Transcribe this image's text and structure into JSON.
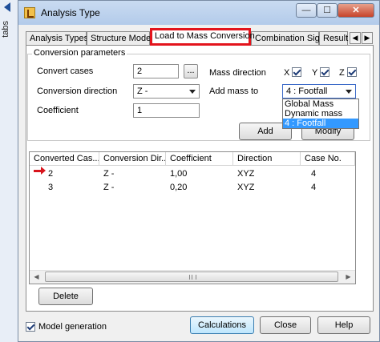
{
  "side": {
    "label": "tabs"
  },
  "window": {
    "title": "Analysis Type",
    "minimize": "—",
    "maximize": "☐",
    "close": "✕"
  },
  "tabs": [
    {
      "label": "Analysis Types"
    },
    {
      "label": "Structure Model"
    },
    {
      "label": "Load to Mass Conversion"
    },
    {
      "label": "Combination Sign"
    },
    {
      "label": "Result"
    }
  ],
  "tab_scroll": {
    "left": "◀",
    "right": "▶"
  },
  "conversion": {
    "group_title": "Conversion parameters",
    "convert_cases_label": "Convert cases",
    "convert_cases_value": "2",
    "browse_label": "...",
    "conversion_direction_label": "Conversion direction",
    "conversion_direction_value": "Z -",
    "coefficient_label": "Coefficient",
    "coefficient_value": "1",
    "mass_direction_label": "Mass direction",
    "mass_x": "X",
    "mass_y": "Y",
    "mass_z": "Z",
    "add_mass_to_label": "Add mass to",
    "add_mass_to_value": "4 : Footfall",
    "dropdown_options": [
      "Global Mass",
      "Dynamic mass",
      "4 : Footfall"
    ],
    "add_button": "Add",
    "modify_button": "Modify"
  },
  "table": {
    "columns": [
      "Converted Cas...",
      "Conversion Dir...",
      "Coefficient",
      "Direction",
      "Case No."
    ],
    "rows": [
      [
        "2",
        "Z -",
        "1,00",
        "XYZ",
        "4"
      ],
      [
        "3",
        "Z -",
        "0,20",
        "XYZ",
        "4"
      ]
    ],
    "scroll_left": "◀",
    "scroll_right": "▶"
  },
  "delete_button": "Delete",
  "footer": {
    "model_generation_label": "Model generation",
    "calculations_button": "Calculations",
    "close_button": "Close",
    "help_button": "Help"
  }
}
